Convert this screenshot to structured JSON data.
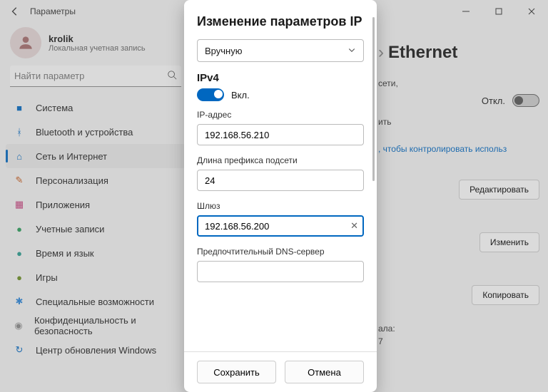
{
  "window": {
    "title": "Параметры",
    "minimize": "–",
    "maximize": "▢",
    "close": "✕"
  },
  "user": {
    "name": "krolik",
    "account_type": "Локальная учетная запись"
  },
  "search": {
    "placeholder": "Найти параметр"
  },
  "sidebar": {
    "items": [
      {
        "label": "Система",
        "color": "#0067c0"
      },
      {
        "label": "Bluetooth и устройства",
        "color": "#0067c0"
      },
      {
        "label": "Сеть и Интернет",
        "color": "#0067c0"
      },
      {
        "label": "Персонализация",
        "color": "#c65b1c"
      },
      {
        "label": "Приложения",
        "color": "#c43b7a"
      },
      {
        "label": "Учетные записи",
        "color": "#2a9d5a"
      },
      {
        "label": "Время и язык",
        "color": "#2a9d8f"
      },
      {
        "label": "Игры",
        "color": "#6b8e23"
      },
      {
        "label": "Специальные возможности",
        "color": "#2a84d8"
      },
      {
        "label": "Конфиденциальность и безопасность",
        "color": "#888"
      },
      {
        "label": "Центр обновления Windows",
        "color": "#0067c0"
      }
    ],
    "active_index": 2
  },
  "right": {
    "breadcrumb_sep": "›",
    "breadcrumb_page": "Ethernet",
    "line1a": "сети,",
    "line1b": "ить",
    "toggle_label": "Откл.",
    "link": ", чтобы контролировать использ",
    "btn_edit": "Редактировать",
    "btn_change": "Изменить",
    "btn_copy": "Копировать",
    "footer_a": "ала:",
    "footer_b": "7"
  },
  "modal": {
    "title": "Изменение параметров IP",
    "select_value": "Вручную",
    "ipv4_section": "IPv4",
    "ipv4_toggle": "Вкл.",
    "fields": {
      "ip_label": "IP-адрес",
      "ip_value": "192.168.56.210",
      "prefix_label": "Длина префикса подсети",
      "prefix_value": "24",
      "gateway_label": "Шлюз",
      "gateway_value": "192.168.56.200",
      "dns_label": "Предпочтительный DNS-сервер",
      "dns_value": ""
    },
    "save": "Сохранить",
    "cancel": "Отмена"
  }
}
